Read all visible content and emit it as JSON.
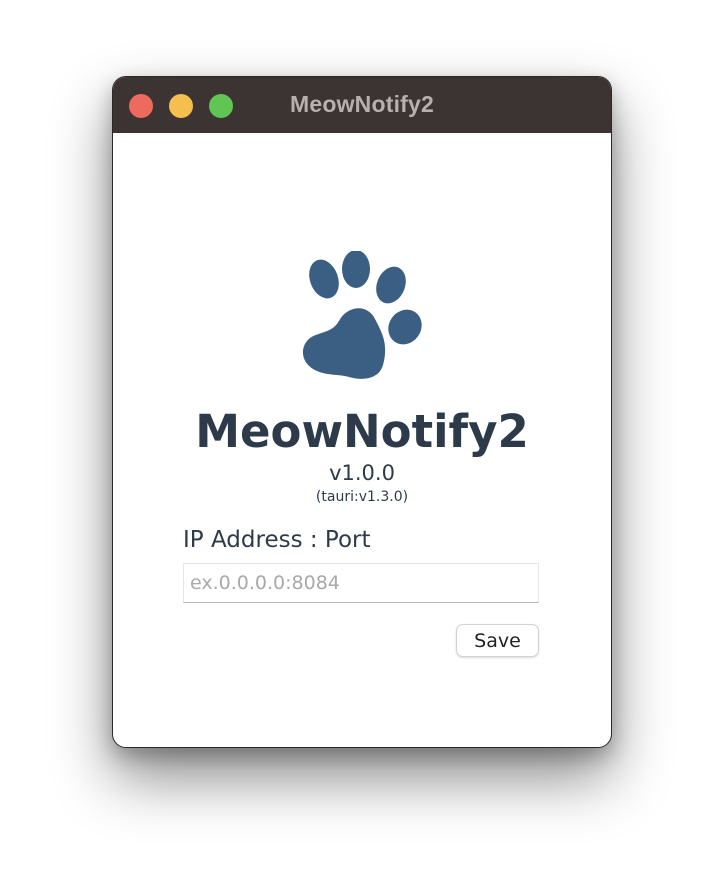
{
  "window": {
    "title": "MeowNotify2"
  },
  "app": {
    "name": "MeowNotify2",
    "version": "v1.0.0",
    "framework": "(tauri:v1.3.0)",
    "logo_icon": "paw-icon",
    "logo_color": "#3a5f82"
  },
  "form": {
    "label": "IP Address : Port",
    "input_value": "",
    "input_placeholder": "ex.0.0.0.0:8084",
    "save_label": "Save"
  },
  "colors": {
    "titlebar": "#3b3433",
    "close": "#ee6a5e",
    "minimize": "#f5bf4f",
    "maximize": "#61c554",
    "text": "#2d3a4a"
  }
}
